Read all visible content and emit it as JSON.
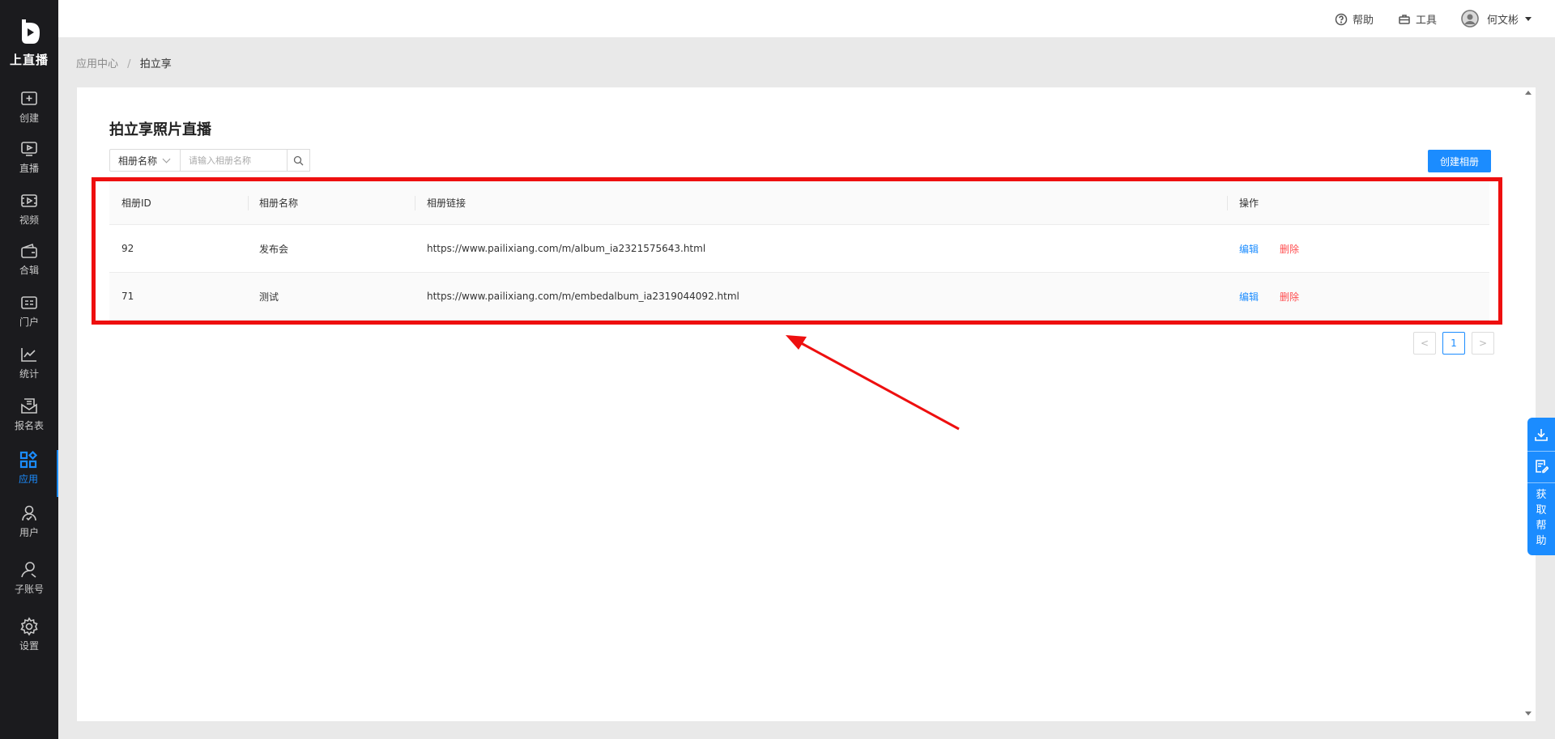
{
  "brand": {
    "name": "上直播"
  },
  "sidebar": {
    "items": [
      {
        "label": "创建",
        "icon": "plus-square-icon"
      },
      {
        "label": "直播",
        "icon": "play-screen-icon"
      },
      {
        "label": "视频",
        "icon": "film-icon"
      },
      {
        "label": "合辑",
        "icon": "wallet-icon"
      },
      {
        "label": "门户",
        "icon": "portal-icon"
      },
      {
        "label": "统计",
        "icon": "line-chart-icon"
      },
      {
        "label": "报名表",
        "icon": "envelope-form-icon"
      },
      {
        "label": "应用",
        "icon": "apps-grid-icon",
        "active": true
      },
      {
        "label": "用户",
        "icon": "user-check-icon"
      },
      {
        "label": "子账号",
        "icon": "user-icon"
      },
      {
        "label": "设置",
        "icon": "gear-icon"
      }
    ]
  },
  "topbar": {
    "help": "帮助",
    "tools": "工具",
    "user": "何文彬"
  },
  "breadcrumb": {
    "parent": "应用中心",
    "separator": "/",
    "current": "拍立享"
  },
  "page": {
    "title": "拍立享照片直播",
    "filter_select": "相册名称",
    "search_placeholder": "请输入相册名称",
    "create_button": "创建相册"
  },
  "table": {
    "headers": [
      "相册ID",
      "相册名称",
      "相册链接",
      "操作"
    ],
    "rows": [
      {
        "id": "92",
        "name": "发布会",
        "link": "https://www.pailixiang.com/m/album_ia2321575643.html",
        "edit": "编辑",
        "delete": "删除"
      },
      {
        "id": "71",
        "name": "测试",
        "link": "https://www.pailixiang.com/m/embedalbum_ia2319044092.html",
        "edit": "编辑",
        "delete": "删除"
      }
    ]
  },
  "pagination": {
    "prev": "<",
    "current": "1",
    "next": ">"
  },
  "float_panel": {
    "text": [
      "获",
      "取",
      "帮",
      "助"
    ]
  },
  "colors": {
    "accent": "#1b8cff",
    "danger": "#ff4d4f",
    "highlight": "#ee0f0f",
    "sidebar_bg": "#1b1b1e"
  }
}
